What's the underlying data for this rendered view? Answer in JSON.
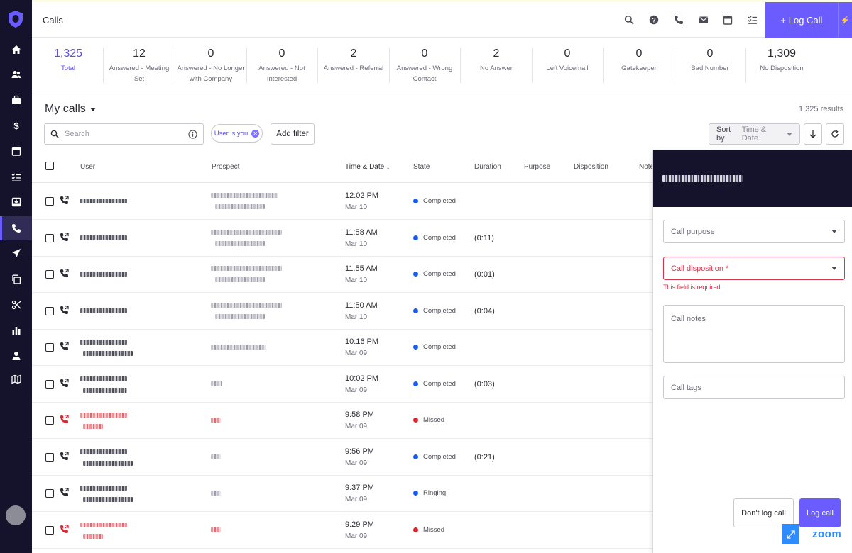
{
  "header": {
    "title": "Calls",
    "log_call_label": "+ Log Call"
  },
  "stats": [
    {
      "value": "1,325",
      "label": "Total"
    },
    {
      "value": "12",
      "label": "Answered - Meeting Set"
    },
    {
      "value": "0",
      "label": "Answered - No Longer with Company"
    },
    {
      "value": "0",
      "label": "Answered - Not Interested"
    },
    {
      "value": "2",
      "label": "Answered - Referral"
    },
    {
      "value": "0",
      "label": "Answered - Wrong Contact"
    },
    {
      "value": "2",
      "label": "No Answer"
    },
    {
      "value": "0",
      "label": "Left Voicemail"
    },
    {
      "value": "0",
      "label": "Gatekeeper"
    },
    {
      "value": "0",
      "label": "Bad Number"
    },
    {
      "value": "1,309",
      "label": "No Disposition"
    }
  ],
  "toolbar": {
    "view_title": "My calls",
    "results": "1,325 results",
    "search_placeholder": "Search",
    "filter_chip": "User is you",
    "add_filter": "Add filter",
    "sort_label": "Sort by",
    "sort_value": "Time & Date"
  },
  "table": {
    "columns": {
      "user": "User",
      "prospect": "Prospect",
      "time_date": "Time & Date ↓",
      "state": "State",
      "duration": "Duration",
      "purpose": "Purpose",
      "disposition": "Disposition",
      "notes": "Note"
    },
    "rows": [
      {
        "time": "12:02 PM",
        "date": "Mar 10",
        "state": "Completed",
        "duration": ""
      },
      {
        "time": "11:58 AM",
        "date": "Mar 10",
        "state": "Completed",
        "duration": "(0:11)"
      },
      {
        "time": "11:55 AM",
        "date": "Mar 10",
        "state": "Completed",
        "duration": "(0:01)"
      },
      {
        "time": "11:50 AM",
        "date": "Mar 10",
        "state": "Completed",
        "duration": "(0:04)"
      },
      {
        "time": "10:16 PM",
        "date": "Mar 09",
        "state": "Completed",
        "duration": ""
      },
      {
        "time": "10:02 PM",
        "date": "Mar 09",
        "state": "Completed",
        "duration": "(0:03)"
      },
      {
        "time": "9:58 PM",
        "date": "Mar 09",
        "state": "Missed",
        "duration": ""
      },
      {
        "time": "9:56 PM",
        "date": "Mar 09",
        "state": "Completed",
        "duration": "(0:21)"
      },
      {
        "time": "9:37 PM",
        "date": "Mar 09",
        "state": "Ringing",
        "duration": ""
      },
      {
        "time": "9:29 PM",
        "date": "Mar 09",
        "state": "Missed",
        "duration": ""
      }
    ]
  },
  "state_colors": {
    "Completed": "#1a5cf0",
    "Missed": "#e0242e",
    "Ringing": "#1a5cf0"
  },
  "panel": {
    "call_purpose": "Call purpose",
    "call_disposition": "Call disposition *",
    "error": "This field is required",
    "call_notes": "Call notes",
    "call_tags": "Call tags",
    "dont_log": "Don't log call",
    "log_call": "Log call",
    "zoom": "zoom"
  },
  "colors": {
    "accent": "#6a5cff",
    "sidebar": "#14132b",
    "error": "#d9344a",
    "zoom": "#2d8cff"
  }
}
